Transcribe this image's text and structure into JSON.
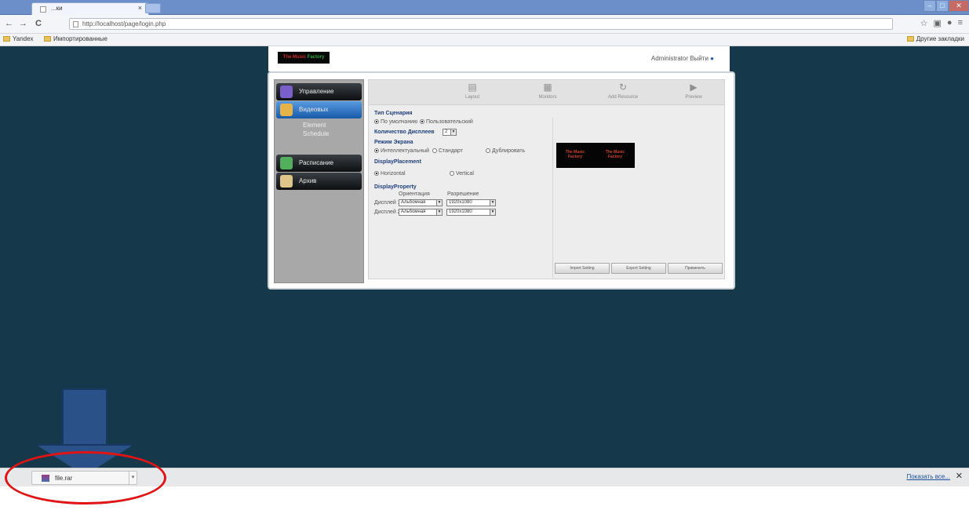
{
  "browser": {
    "tab_title": "...ки",
    "tab_close": "×",
    "url": "http://localhost/page/login.php",
    "nav": {
      "back": "←",
      "forward": "→",
      "reload": "C"
    },
    "bookmarks": [
      {
        "label": "Yandex"
      },
      {
        "label": "Импортированные"
      }
    ],
    "bookmarks_right": "Другие закладки",
    "window_controls": {
      "minimize": "–",
      "maximize": "□",
      "close": "✕"
    }
  },
  "app": {
    "logo_text_red": "The Music",
    "logo_text_green": " Factory",
    "admin_label": "Administrator",
    "logout_label": "Выйти",
    "sidebar": [
      {
        "label": "Управление",
        "active": false
      },
      {
        "label": "Видеовых",
        "active": true
      },
      {
        "label": "Расписание",
        "active": false
      },
      {
        "label": "Архив",
        "active": false
      }
    ],
    "sub_items": [
      "Element",
      "Schedule"
    ],
    "tools": [
      {
        "icon": "layout-icon",
        "label": "Layout"
      },
      {
        "icon": "monitor-icon",
        "label": "Monitors"
      },
      {
        "icon": "refresh-icon",
        "label": "Add Resource"
      },
      {
        "icon": "play-icon",
        "label": "Preview"
      }
    ],
    "form": {
      "scenario_heading": "Тип Сценария",
      "scenario_options": [
        "По умолчанию",
        "Пользовательский"
      ],
      "displays_heading": "Количество Дисплеев",
      "displays_value": "2",
      "mode_heading": "Режим Экрана",
      "mode_options": [
        "Интеллектуальный",
        "Стандарт",
        "Дублировать"
      ],
      "placement_heading": "DisplayPlacement",
      "placement_options": [
        "Horizontal",
        "Vertical"
      ],
      "property_heading": "DisplayProperty",
      "col1_label": "Ориентация",
      "col2_label": "Разрешение",
      "row1_label": "Дисплей 1",
      "row1_orient": "Альбомная",
      "row1_res": "1920x1080",
      "row2_label": "Дисплей 2",
      "row2_orient": "Альбомная",
      "row2_res": "1920x1080"
    },
    "preview_logos": [
      "The Music Factory",
      "The Music Factory"
    ],
    "actions": [
      "Import Setting",
      "Export Setting",
      "Применить"
    ]
  },
  "shelf": {
    "file_name": "file.rar",
    "show_all": "Показать все...",
    "close": "✕"
  },
  "overlay": {
    "arrow_color": "#2b5189",
    "circle_color": "#e01414"
  }
}
